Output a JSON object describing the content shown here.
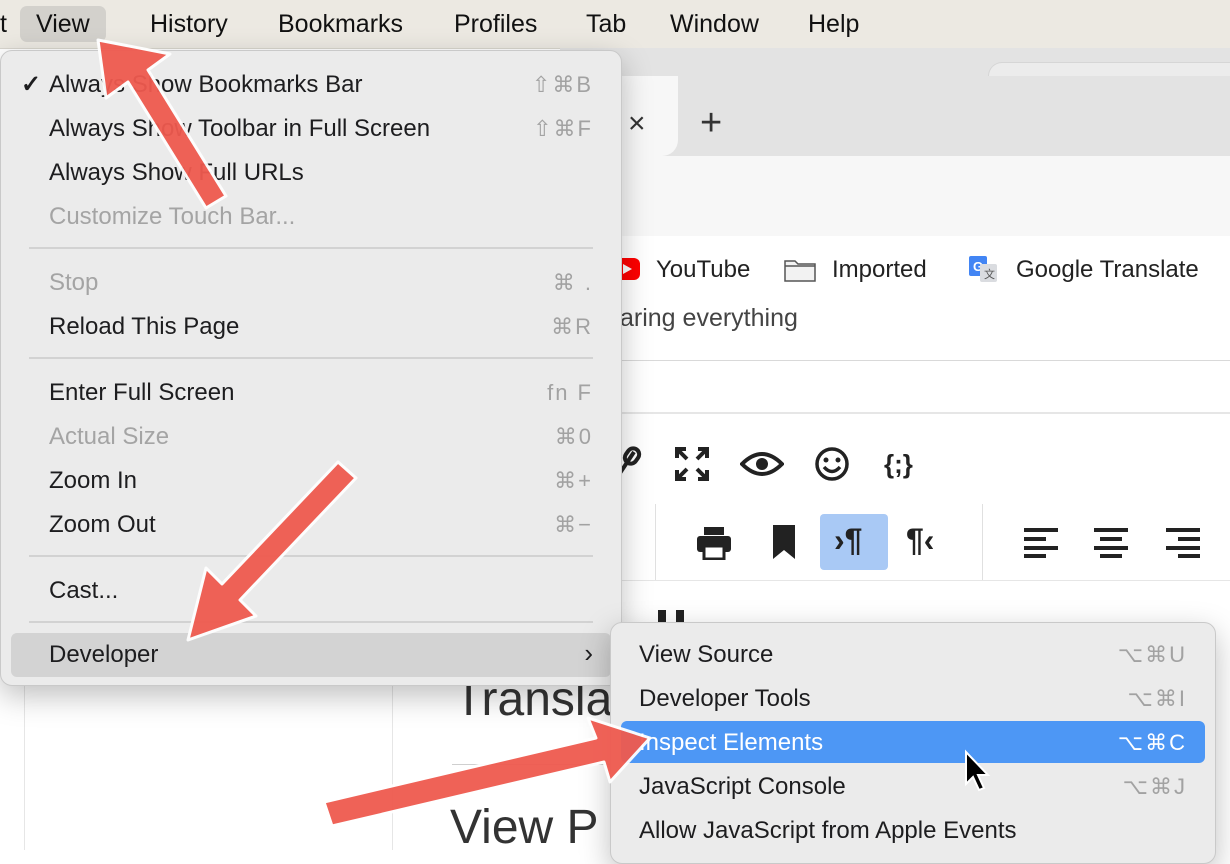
{
  "menubar": {
    "items": [
      {
        "label": "t"
      },
      {
        "label": "View"
      },
      {
        "label": "History"
      },
      {
        "label": "Bookmarks"
      },
      {
        "label": "Profiles"
      },
      {
        "label": "Tab"
      },
      {
        "label": "Window"
      },
      {
        "label": "Help"
      }
    ]
  },
  "browser": {
    "tab_close": "×",
    "new_tab": "+",
    "bookmarks": [
      {
        "label": "YouTube",
        "icon": "youtube-icon"
      },
      {
        "label": "Imported",
        "icon": "folder-icon"
      },
      {
        "label": "Google Translate",
        "icon": "google-translate-icon"
      }
    ],
    "page_text": "aring everything",
    "text_translate": "Transla",
    "text_view": "View P"
  },
  "view_menu": {
    "items": [
      {
        "label": "Always Show Bookmarks Bar",
        "shortcut": "⇧⌘B",
        "checked": true,
        "enabled": true
      },
      {
        "label": "Always Show Toolbar in Full Screen",
        "shortcut": "⇧⌘F",
        "enabled": true
      },
      {
        "label": "Always Show Full URLs",
        "shortcut": "",
        "enabled": true
      },
      {
        "label": "Customize Touch Bar...",
        "shortcut": "",
        "enabled": false
      },
      {
        "label": "Stop",
        "shortcut": "⌘ .",
        "enabled": false
      },
      {
        "label": "Reload This Page",
        "shortcut": "⌘R",
        "enabled": true
      },
      {
        "label": "Enter Full Screen",
        "shortcut": "fn F",
        "enabled": true
      },
      {
        "label": "Actual Size",
        "shortcut": "⌘0",
        "enabled": false
      },
      {
        "label": "Zoom In",
        "shortcut": "⌘+",
        "enabled": true
      },
      {
        "label": "Zoom Out",
        "shortcut": "⌘−",
        "enabled": true
      },
      {
        "label": "Cast...",
        "shortcut": "",
        "enabled": true
      },
      {
        "label": "Developer",
        "shortcut": "",
        "enabled": true,
        "submenu": true
      }
    ],
    "check_mark": "✓",
    "chevron": "›"
  },
  "developer_menu": {
    "items": [
      {
        "label": "View Source",
        "shortcut": "⌥⌘U"
      },
      {
        "label": "Developer Tools",
        "shortcut": "⌥⌘I"
      },
      {
        "label": "Inspect Elements",
        "shortcut": "⌥⌘C",
        "highlighted": true
      },
      {
        "label": "JavaScript Console",
        "shortcut": "⌥⌘J"
      },
      {
        "label": "Allow JavaScript from Apple Events",
        "shortcut": ""
      }
    ]
  },
  "colors": {
    "highlight": "#4d97f5",
    "arrow": "#ef5a4f"
  }
}
